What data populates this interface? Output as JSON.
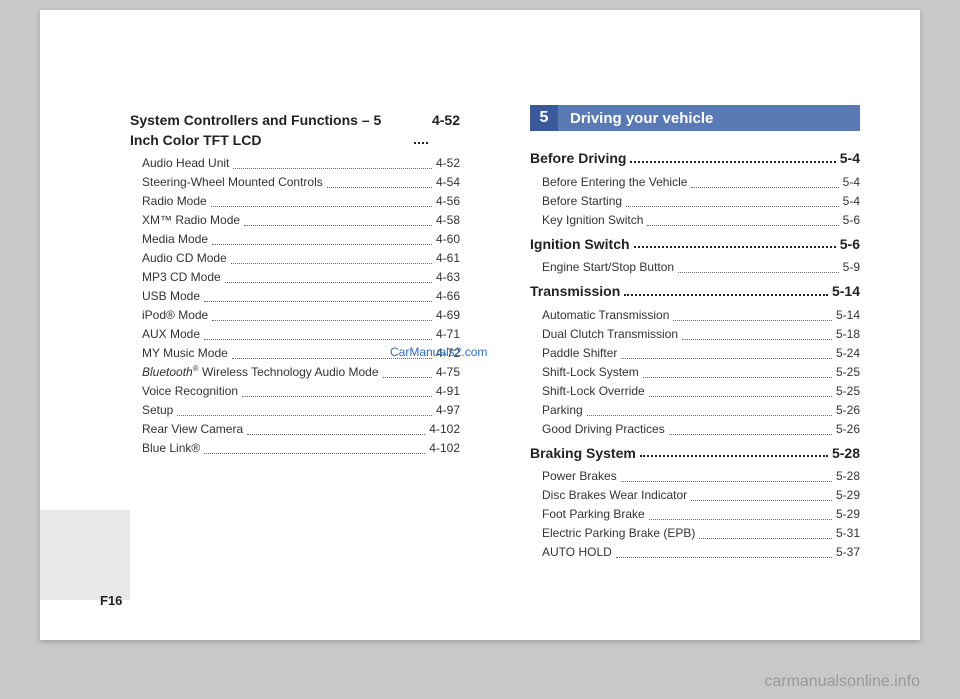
{
  "page_number": "F16",
  "site_credit": "carmanualsonline.info",
  "watermark": "CarManuals2.com",
  "chapter": {
    "num": "5",
    "title": "Driving your vehicle"
  },
  "left": {
    "headings": [
      {
        "label": "System Controllers and Functions – 5 Inch Color TFT LCD",
        "page": "4-52"
      }
    ],
    "subs": [
      {
        "label": "Audio Head Unit",
        "page": "4-52"
      },
      {
        "label": "Steering-Wheel Mounted Controls",
        "page": "4-54"
      },
      {
        "label": "Radio Mode",
        "page": "4-56"
      },
      {
        "label": "XM™ Radio Mode",
        "page": "4-58"
      },
      {
        "label": "Media Mode",
        "page": "4-60"
      },
      {
        "label": "Audio CD Mode",
        "page": "4-61"
      },
      {
        "label": "MP3 CD Mode",
        "page": "4-63"
      },
      {
        "label": "USB Mode",
        "page": "4-66"
      },
      {
        "label": "iPod® Mode",
        "page": "4-69"
      },
      {
        "label": "AUX Mode",
        "page": "4-71"
      },
      {
        "label": "MY Music Mode",
        "page": "4-72"
      },
      {
        "label_html": "Bluetooth® Wireless Technology Audio Mode",
        "label": "Bluetooth® Wireless Technology Audio Mode",
        "page": "4-75",
        "italic_prefix": true
      },
      {
        "label": "Voice Recognition",
        "page": "4-91"
      },
      {
        "label": "Setup",
        "page": "4-97"
      },
      {
        "label": "Rear View Camera",
        "page": "4-102"
      },
      {
        "label": "Blue Link®",
        "page": "4-102"
      }
    ]
  },
  "right": [
    {
      "heading": {
        "label": "Before Driving",
        "page": "5-4"
      },
      "subs": [
        {
          "label": "Before Entering the Vehicle",
          "page": "5-4"
        },
        {
          "label": "Before Starting",
          "page": "5-4"
        },
        {
          "label": "Key Ignition Switch",
          "page": "5-6"
        }
      ]
    },
    {
      "heading": {
        "label": "Ignition Switch",
        "page": "5-6"
      },
      "subs": [
        {
          "label": "Engine Start/Stop Button",
          "page": "5-9"
        }
      ]
    },
    {
      "heading": {
        "label": "Transmission",
        "page": "5-14"
      },
      "subs": [
        {
          "label": "Automatic Transmission",
          "page": "5-14"
        },
        {
          "label": "Dual Clutch Transmission",
          "page": "5-18"
        },
        {
          "label": "Paddle Shifter",
          "page": "5-24"
        },
        {
          "label": "Shift-Lock System",
          "page": "5-25"
        },
        {
          "label": "Shift-Lock Override",
          "page": "5-25"
        },
        {
          "label": "Parking",
          "page": "5-26"
        },
        {
          "label": "Good Driving Practices",
          "page": "5-26"
        }
      ]
    },
    {
      "heading": {
        "label": "Braking System",
        "page": "5-28"
      },
      "subs": [
        {
          "label": "Power Brakes",
          "page": "5-28"
        },
        {
          "label": "Disc Brakes Wear Indicator",
          "page": "5-29"
        },
        {
          "label": "Foot Parking Brake",
          "page": "5-29"
        },
        {
          "label": "Electric Parking Brake (EPB)",
          "page": "5-31"
        },
        {
          "label": "AUTO HOLD",
          "page": "5-37"
        }
      ]
    }
  ]
}
